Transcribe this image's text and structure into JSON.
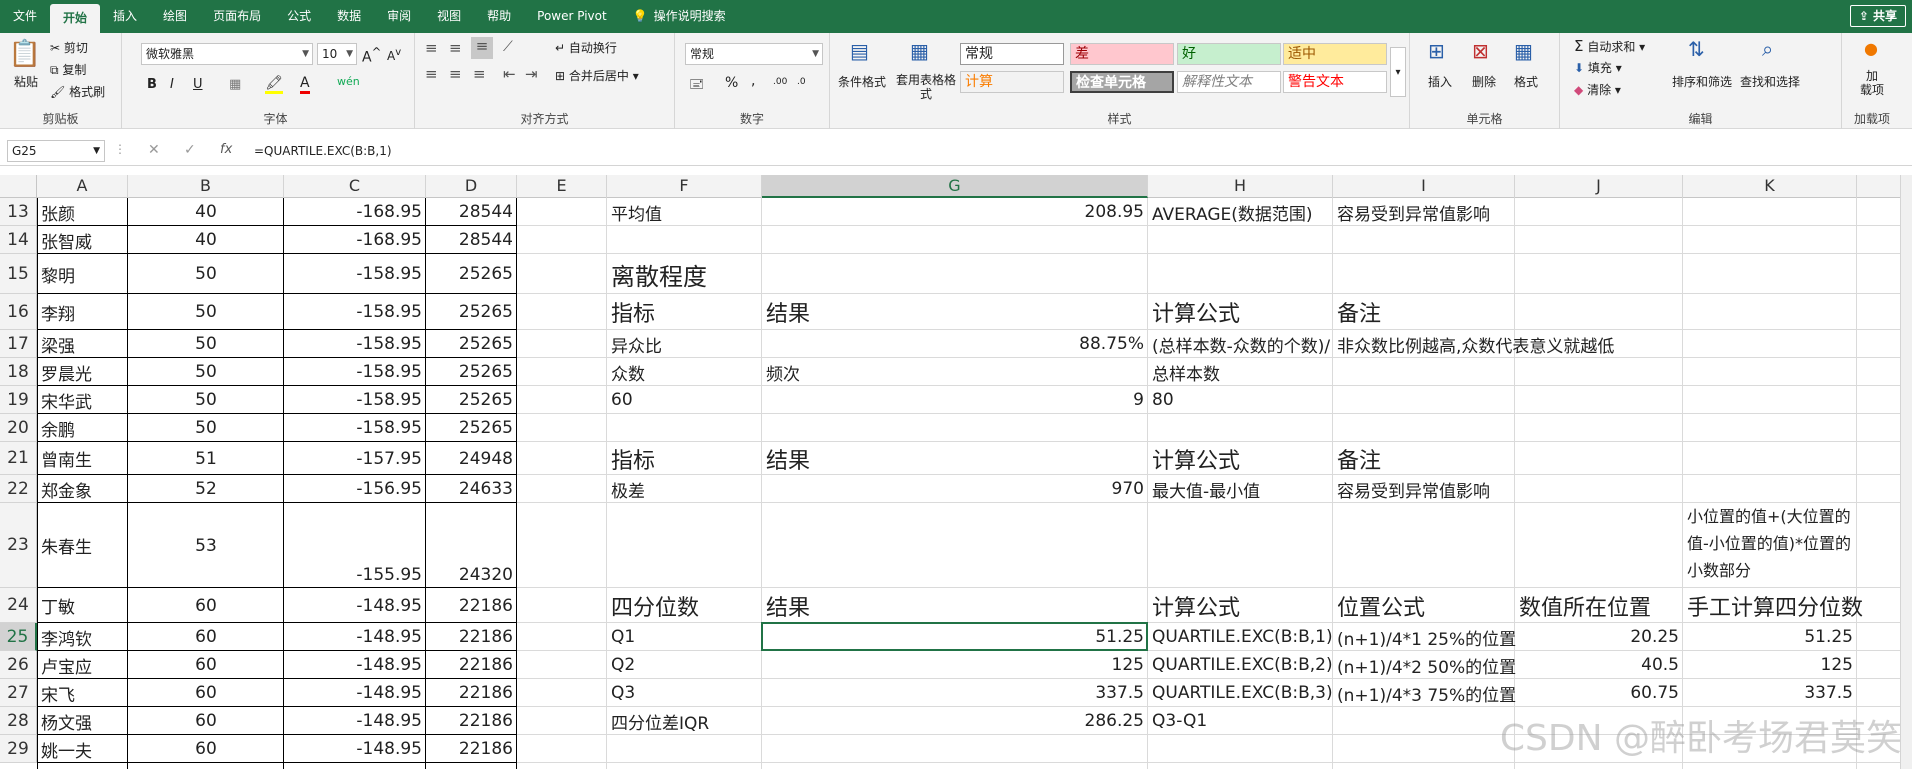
{
  "tabs": [
    "文件",
    "开始",
    "插入",
    "绘图",
    "页面布局",
    "公式",
    "数据",
    "审阅",
    "视图",
    "帮助",
    "Power Pivot",
    "操作说明搜索"
  ],
  "share_label": "共享",
  "ribbon": {
    "clipboard": {
      "paste": "粘贴",
      "cut": "剪切",
      "copy": "复制",
      "format_painter": "格式刷",
      "label": "剪贴板"
    },
    "font": {
      "name": "微软雅黑",
      "size": "10",
      "label": "字体",
      "bold": "B",
      "italic": "I",
      "underline": "U"
    },
    "alignment": {
      "wrap": "自动换行",
      "merge": "合并后居中",
      "label": "对齐方式"
    },
    "number": {
      "format": "常规",
      "label": "数字",
      "percent": "%",
      "comma": ","
    },
    "styles": {
      "conditional": "条件格式",
      "table": "套用表格格式",
      "cells": [
        {
          "text": "常规",
          "bg": "#ffffff",
          "color": "#222222"
        },
        {
          "text": "差",
          "bg": "#ffc7ce",
          "color": "#9c0006"
        },
        {
          "text": "好",
          "bg": "#c6efce",
          "color": "#006100"
        },
        {
          "text": "适中",
          "bg": "#ffeb9c",
          "color": "#9c5700"
        },
        {
          "text": "计算",
          "bg": "#f2f2f2",
          "color": "#fa7d00"
        },
        {
          "text": "检查单元格",
          "bg": "#a5a5a5",
          "color": "#ffffff"
        },
        {
          "text": "解释性文本",
          "bg": "#ffffff",
          "color": "#7f7f7f"
        },
        {
          "text": "警告文本",
          "bg": "#ffffff",
          "color": "#ff0000"
        }
      ],
      "label": "样式"
    },
    "cells_group": {
      "insert": "插入",
      "delete": "删除",
      "format": "格式",
      "label": "单元格"
    },
    "editing": {
      "autosum": "自动求和",
      "fill": "填充",
      "clear": "清除",
      "sort": "排序和筛选",
      "find": "查找和选择",
      "label": "编辑"
    },
    "addins": {
      "load": "加\n载项",
      "label": "加载项"
    }
  },
  "formula_bar": {
    "name_box": "G25",
    "formula": "=QUARTILE.EXC(B:B,1)"
  },
  "columns": [
    "A",
    "B",
    "C",
    "D",
    "E",
    "F",
    "G",
    "H",
    "I",
    "J",
    "K"
  ],
  "rows": [
    {
      "n": "13",
      "A": "张颜",
      "B": "40",
      "C": "-168.95",
      "D": "28544",
      "F": "平均值",
      "G": "208.95",
      "H": "AVERAGE(数据范围)",
      "I": "容易受到异常值影响"
    },
    {
      "n": "14",
      "A": "张智威",
      "B": "40",
      "C": "-168.95",
      "D": "28544"
    },
    {
      "n": "15",
      "A": "黎明",
      "B": "50",
      "C": "-158.95",
      "D": "25265",
      "F": "离散程度"
    },
    {
      "n": "16",
      "A": "李翔",
      "B": "50",
      "C": "-158.95",
      "D": "25265",
      "F": "指标",
      "G": "结果",
      "H": "计算公式",
      "I": "备注"
    },
    {
      "n": "17",
      "A": "梁强",
      "B": "50",
      "C": "-158.95",
      "D": "25265",
      "F": "异众比",
      "G": "88.75%",
      "H": "(总样本数-众数的个数)/",
      "I": "非众数比例越高,众数代表意义就越低"
    },
    {
      "n": "18",
      "A": "罗晨光",
      "B": "50",
      "C": "-158.95",
      "D": "25265",
      "F": "众数",
      "G": "频次",
      "H": "总样本数"
    },
    {
      "n": "19",
      "A": "宋华武",
      "B": "50",
      "C": "-158.95",
      "D": "25265",
      "F": "60",
      "G": "9",
      "H": "80"
    },
    {
      "n": "20",
      "A": "余鹏",
      "B": "50",
      "C": "-158.95",
      "D": "25265"
    },
    {
      "n": "21",
      "A": "曾南生",
      "B": "51",
      "C": "-157.95",
      "D": "24948",
      "F": "指标",
      "G": "结果",
      "H": "计算公式",
      "I": "备注"
    },
    {
      "n": "22",
      "A": "郑金象",
      "B": "52",
      "C": "-156.95",
      "D": "24633",
      "F": "极差",
      "G": "970",
      "H": "最大值-最小值",
      "I": "容易受到异常值影响"
    },
    {
      "n": "23",
      "A": "朱春生",
      "B": "53",
      "C": "-155.95",
      "D": "24320",
      "K": "小位置的值+(大位置的值-小位置的值)*位置的小数部分"
    },
    {
      "n": "24",
      "A": "丁敏",
      "B": "60",
      "C": "-148.95",
      "D": "22186",
      "F": "四分位数",
      "G": "结果",
      "H": "计算公式",
      "I": "位置公式",
      "J": "数值所在位置",
      "K": "手工计算四分位数"
    },
    {
      "n": "25",
      "A": "李鸿钦",
      "B": "60",
      "C": "-148.95",
      "D": "22186",
      "F": "Q1",
      "G": "51.25",
      "H": "QUARTILE.EXC(B:B,1)",
      "I": "(n+1)/4*1   25%的位置",
      "J": "20.25",
      "K": "51.25"
    },
    {
      "n": "26",
      "A": "卢宝应",
      "B": "60",
      "C": "-148.95",
      "D": "22186",
      "F": "Q2",
      "G": "125",
      "H": "QUARTILE.EXC(B:B,2)",
      "I": "(n+1)/4*2   50%的位置",
      "J": "40.5",
      "K": "125"
    },
    {
      "n": "27",
      "A": "宋飞",
      "B": "60",
      "C": "-148.95",
      "D": "22186",
      "F": "Q3",
      "G": "337.5",
      "H": "QUARTILE.EXC(B:B,3)",
      "I": "(n+1)/4*3   75%的位置",
      "J": "60.75",
      "K": "337.5"
    },
    {
      "n": "28",
      "A": "杨文强",
      "B": "60",
      "C": "-148.95",
      "D": "22186",
      "F": "四分位差IQR",
      "G": "286.25",
      "H": "Q3-Q1"
    },
    {
      "n": "29",
      "A": "姚一夫",
      "B": "60",
      "C": "-148.95",
      "D": "22186"
    }
  ],
  "watermark": "CSDN @醉卧考场君莫笑",
  "accent": "#217346"
}
